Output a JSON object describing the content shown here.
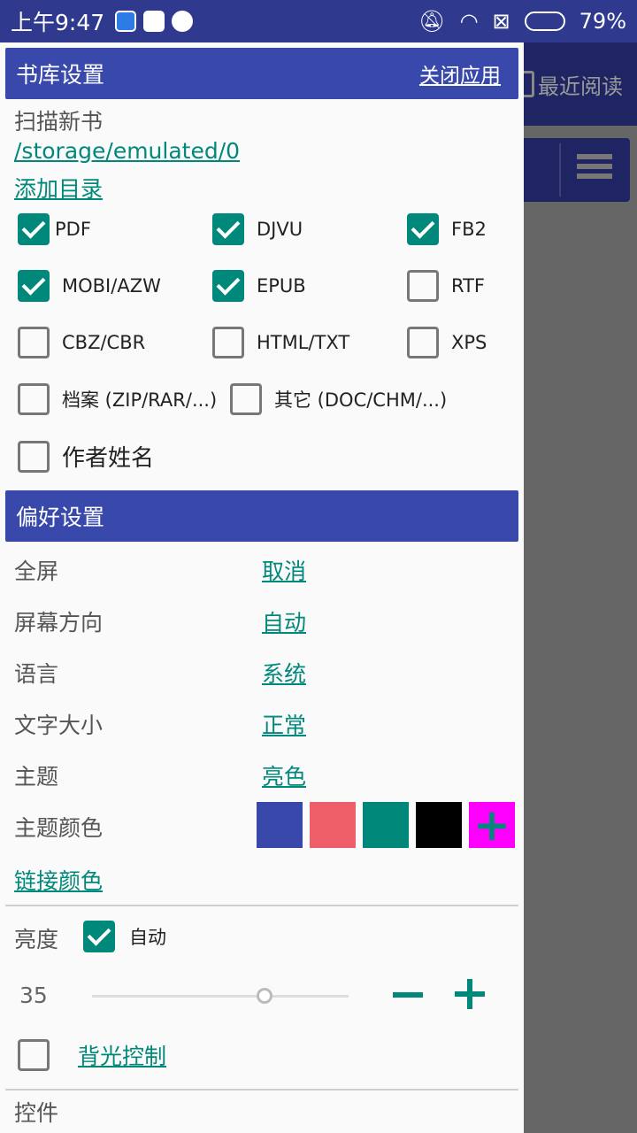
{
  "status_bar": {
    "time": "上午9:47",
    "battery": "79%",
    "battery_level": 0.79
  },
  "background_app": {
    "recent_label": "最近阅读"
  },
  "library": {
    "header": "书库设置",
    "close_app": "关闭应用",
    "scan_label": "扫描新书",
    "path": "/storage/emulated/0",
    "add_dir": "添加目录",
    "formats": [
      {
        "label": "PDF",
        "checked": true
      },
      {
        "label": "DJVU",
        "checked": true
      },
      {
        "label": "FB2",
        "checked": true
      },
      {
        "label": "MOBI/AZW",
        "checked": true
      },
      {
        "label": "EPUB",
        "checked": true
      },
      {
        "label": "RTF",
        "checked": false
      },
      {
        "label": "CBZ/CBR",
        "checked": false
      },
      {
        "label": "HTML/TXT",
        "checked": false
      },
      {
        "label": "XPS",
        "checked": false
      },
      {
        "label": "档案 (ZIP/RAR/...)",
        "checked": false
      },
      {
        "label": "其它 (DOC/CHM/...)",
        "checked": false
      }
    ],
    "author_name": {
      "label": "作者姓名",
      "checked": false
    }
  },
  "preferences": {
    "header": "偏好设置",
    "rows": [
      {
        "label": "全屏",
        "value": "取消"
      },
      {
        "label": "屏幕方向",
        "value": "自动"
      },
      {
        "label": "语言",
        "value": "系统"
      },
      {
        "label": "文字大小",
        "value": "正常"
      },
      {
        "label": "主题",
        "value": "亮色"
      }
    ],
    "theme_color_label": "主题颜色",
    "theme_colors": [
      "#3949ab",
      "#ef5f6a",
      "#00897b",
      "#000000"
    ],
    "add_color_color": "#ff00ff",
    "link_color_label": "链接颜色",
    "brightness_label": "亮度",
    "brightness_auto": {
      "label": "自动",
      "checked": true
    },
    "brightness_value": "35",
    "backlight": {
      "label": "背光控制",
      "checked": false
    },
    "controls_label": "控件"
  },
  "colors": {
    "accent": "#00897b",
    "header": "#3949ab",
    "statusbar": "#2f3a8f"
  }
}
